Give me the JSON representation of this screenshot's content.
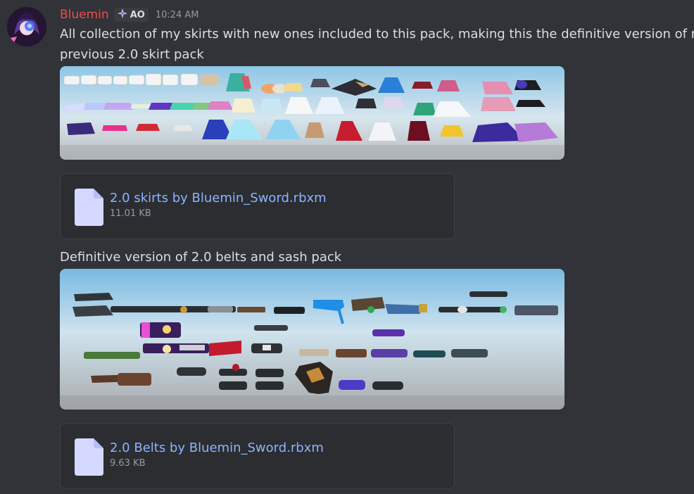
{
  "colors": {
    "username": "#f04b4b",
    "link": "#8cb4ff",
    "background": "#313338",
    "attachment_bg": "#2b2d31"
  },
  "message": {
    "author": "Bluemin",
    "tag": "AO",
    "tag_icon": "sparkle-icon",
    "timestamp": "10:24 AM",
    "text_line1": "All collection of my skirts with new ones included to this pack, making this the definitive version of my",
    "text_line2": "previous 2.0 skirt pack",
    "text2": "Definitive version of 2.0 belts and sash pack"
  },
  "attachments": [
    {
      "name": "2.0 skirts by Bluemin_Sword.rbxm",
      "size": "11.01 KB",
      "icon": "file-icon"
    },
    {
      "name": "2.0 Belts by Bluemin_Sword.rbxm",
      "size": "9.63 KB",
      "icon": "file-icon"
    }
  ],
  "images": [
    {
      "icon": "skirts-collection-image"
    },
    {
      "icon": "belts-collection-image"
    }
  ]
}
